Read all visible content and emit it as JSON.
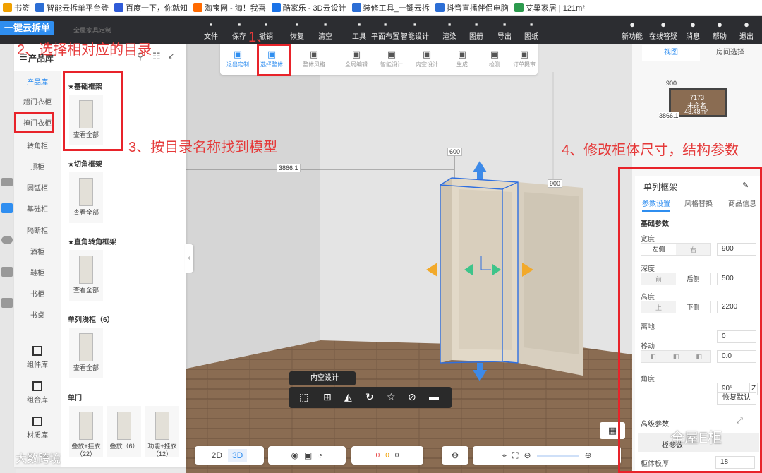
{
  "bookmarks": [
    {
      "label": "书签",
      "color": "#f0a000"
    },
    {
      "label": "智能云拆单平台登",
      "color": "#2c6ed5"
    },
    {
      "label": "百度一下，你就知",
      "color": "#2f5bd8"
    },
    {
      "label": "淘宝网 - 淘！我喜",
      "color": "#ff6a00"
    },
    {
      "label": "酷家乐 - 3D云设计",
      "color": "#1a73e8"
    },
    {
      "label": "装修工具_一键云拆",
      "color": "#2c6ed5"
    },
    {
      "label": "抖音直播伴侣电脑",
      "color": "#2c6ed5"
    },
    {
      "label": "艾巢家居 | 121m²",
      "color": "#2c9a4d"
    }
  ],
  "app": {
    "logo": "一键云拆单",
    "subtitle": "全屋家具定制"
  },
  "toolbar": [
    "文件",
    "保存",
    "撤销",
    "恢复",
    "清空",
    "工具",
    "平面布置",
    "智能设计",
    "渲染",
    "图册",
    "导出",
    "图纸"
  ],
  "toolbar_icons": [
    "folder-icon",
    "save-icon",
    "undo-icon",
    "redo-icon",
    "eraser-icon",
    "wrench-icon",
    "floorplan-icon",
    "smart-design-icon",
    "render-icon",
    "album-icon",
    "export-icon",
    "drawing-icon"
  ],
  "topright": [
    "新功能",
    "在线答疑",
    "消息",
    "帮助",
    "退出"
  ],
  "subtoolbar": [
    "退出定制",
    "选择整体",
    "整体风格",
    "全局编辑",
    "智能设计",
    "内空设计",
    "生成",
    "检测",
    "订单提审"
  ],
  "library": {
    "title": "产品库",
    "categories": [
      "产品库",
      "趟门衣柜",
      "掩门衣柜",
      "转角柜",
      "顶柜",
      "圆弧柜",
      "基础柜",
      "隔断柜",
      "酒柜",
      "鞋柜",
      "书柜",
      "书桌"
    ],
    "bottom_tabs": [
      "组件库",
      "组合库",
      "材质库"
    ],
    "sections": [
      {
        "title": "★基础框架",
        "cards": [
          {
            "label": "查看全部"
          }
        ]
      },
      {
        "title": "★切角框架",
        "cards": [
          {
            "label": "查看全部"
          }
        ]
      },
      {
        "title": "★直角转角框架",
        "cards": [
          {
            "label": "查看全部"
          }
        ]
      },
      {
        "title": "单列浅柜（6）",
        "cards": [
          {
            "label": "查看全部"
          }
        ]
      },
      {
        "title": "单门",
        "cards": [
          {
            "label": "叠放+挂衣（22）"
          },
          {
            "label": "叠放（6）"
          },
          {
            "label": "功能+挂衣（12）"
          }
        ]
      }
    ]
  },
  "viewport": {
    "dims": {
      "width_label": "3866.1",
      "depth_label": "600",
      "cabinet_label": "900"
    },
    "toolbar_title": "内空设计"
  },
  "minimap": {
    "tabs": [
      "视图",
      "房间选择"
    ],
    "labels": {
      "top": "900",
      "right": "7173",
      "name": "未命名",
      "area": "43.48m²",
      "left": "3866.1"
    }
  },
  "params": {
    "title": "单列框架",
    "tabs": [
      "参数设置",
      "风格替换",
      "商品信息"
    ],
    "section": "基础参数",
    "rows": [
      {
        "label": "宽度",
        "seg": [
          "左侧",
          "右"
        ],
        "value": "900"
      },
      {
        "label": "深度",
        "seg": [
          "前",
          "后侧"
        ],
        "value": "500"
      },
      {
        "label": "高度",
        "seg": [
          "上",
          "下侧"
        ],
        "value": "2200"
      },
      {
        "label": "离地",
        "value": "0"
      },
      {
        "label": "移动",
        "value": "0.0"
      },
      {
        "label": "角度",
        "value": "90°",
        "unit": "Z"
      }
    ],
    "reset": "恢复默认",
    "advanced": "高级参数",
    "sub": "板参数",
    "thickness_label": "柜体板厚",
    "thickness_value": "18"
  },
  "bottom": {
    "mode_2d": "2D",
    "mode_3d": "3D",
    "counts": [
      "0",
      "0",
      "0"
    ]
  },
  "annotations": {
    "a1": "1、",
    "a2": "2、选择相对应的目录",
    "a3": "3、按目录名称找到模型",
    "a4": "4、修改柜体尺寸，结构参数"
  },
  "watermarks": {
    "left": "大数跨境",
    "right": "全屋E柜"
  },
  "colors": {
    "accent": "#2f8ef0",
    "annotation": "#e8232a",
    "topbar": "#2c2d31"
  }
}
